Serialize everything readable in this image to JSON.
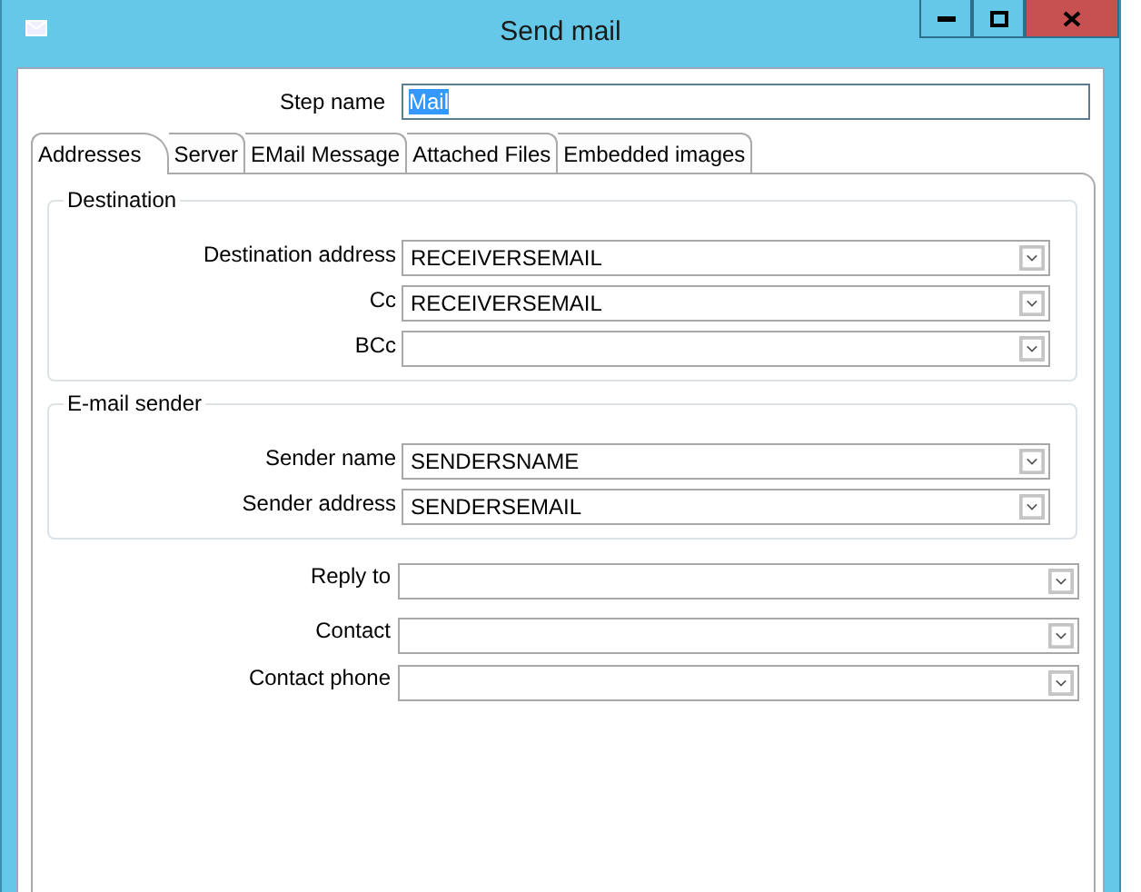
{
  "window": {
    "title": "Send mail"
  },
  "step_name": {
    "label": "Step name",
    "value": "Mail",
    "text_selected": true
  },
  "tabs": [
    {
      "label": "Addresses",
      "selected": true
    },
    {
      "label": "Server",
      "selected": false
    },
    {
      "label": "EMail Message",
      "selected": false
    },
    {
      "label": "Attached Files",
      "selected": false
    },
    {
      "label": "Embedded images",
      "selected": false
    }
  ],
  "groups": [
    {
      "title": "Destination",
      "fields": [
        {
          "label": "Destination address",
          "value": "RECEIVERSEMAIL"
        },
        {
          "label": "Cc",
          "value": "RECEIVERSEMAIL"
        },
        {
          "label": "BCc"
        }
      ]
    },
    {
      "title": "E-mail sender",
      "fields": [
        {
          "label": "Sender name",
          "value": "SENDERSNAME"
        },
        {
          "label": "Sender address",
          "value": "SENDERSEMAIL"
        }
      ]
    }
  ],
  "fields": [
    {
      "label": "Reply to"
    },
    {
      "label": "Contact"
    },
    {
      "label": "Contact phone"
    }
  ]
}
